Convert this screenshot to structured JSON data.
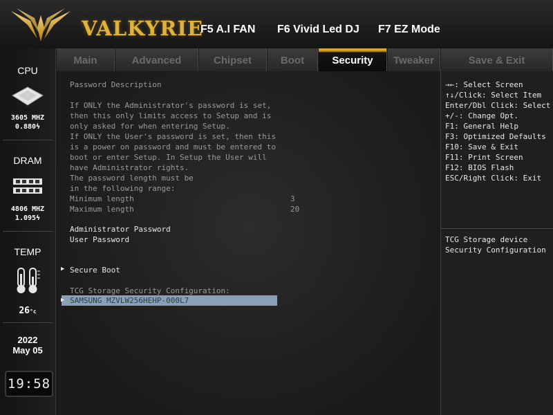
{
  "header": {
    "brand": "VALKYRIE",
    "hotkeys": [
      "F5 A.I FAN",
      "F6 Vivid Led DJ",
      "F7 EZ Mode"
    ],
    "accent_color": "#e0b23a"
  },
  "sidebar": {
    "cpu": {
      "title": "CPU",
      "freq": "3605 MHZ",
      "volt": "0.880",
      "icon": "cpu-chip-icon"
    },
    "dram": {
      "title": "DRAM",
      "freq": "4806 MHZ",
      "volt": "1.095",
      "icon": "ram-module-icon"
    },
    "temp": {
      "title": "TEMP",
      "value": "26",
      "unit": "°c",
      "icon": "thermometer-icon"
    },
    "date": {
      "year": "2022",
      "month_day": "May 05"
    },
    "clock": "19:58"
  },
  "tabs": [
    {
      "label": "Main"
    },
    {
      "label": "Advanced"
    },
    {
      "label": "Chipset"
    },
    {
      "label": "Boot"
    },
    {
      "label": "Security",
      "active": true
    },
    {
      "label": "Tweaker"
    },
    {
      "label": "Save & Exit"
    }
  ],
  "main": {
    "description": [
      "Password Description",
      "",
      "If ONLY the Administrator's password is set,",
      "then this only limits access to Setup and is",
      "only asked for when entering Setup.",
      "If ONLY the User's password is set, then this",
      "is a power on password and must be entered to",
      "boot or enter Setup. In Setup the User will",
      "have Administrator rights.",
      "The password length must be",
      "in the following range:"
    ],
    "min_length_label": "Minimum length",
    "min_length_value": "3",
    "max_length_label": "Maximum length",
    "max_length_value": "20",
    "admin_password": "Administrator Password",
    "user_password": "User Password",
    "secure_boot": "Secure Boot",
    "tcg_header": "TCG Storage Security Configuration:",
    "tcg_device": "SAMSUNG MZVLW256HEHP-000L7"
  },
  "help": {
    "keys": [
      "→←: Select Screen",
      "↑↓/Click: Select Item",
      "Enter/Dbl Click: Select",
      "+/-: Change Opt.",
      "F1: General Help",
      "F3: Optimized Defaults",
      "F10: Save & Exit",
      "F11: Print Screen",
      "F12: BIOS Flash",
      "ESC/Right Click: Exit"
    ],
    "item_help": [
      "TCG Storage device",
      "Security Configuration"
    ]
  }
}
